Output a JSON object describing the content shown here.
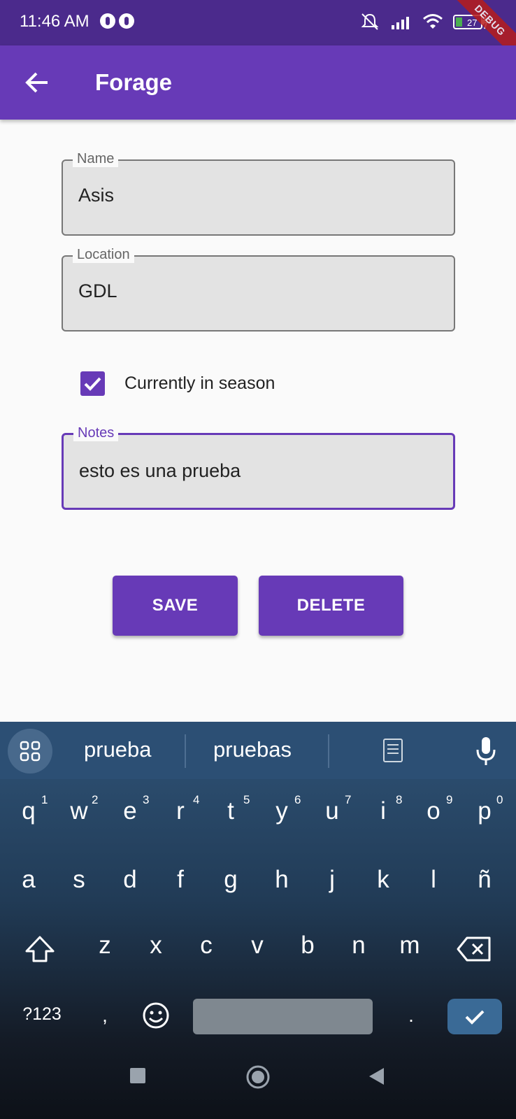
{
  "status_bar": {
    "time": "11:46 AM",
    "battery": "27",
    "debug_banner": "DEBUG"
  },
  "app_bar": {
    "title": "Forage"
  },
  "form": {
    "name": {
      "label": "Name",
      "value": "Asis"
    },
    "location": {
      "label": "Location",
      "value": "GDL"
    },
    "in_season": {
      "label": "Currently in season",
      "checked": true
    },
    "notes": {
      "label": "Notes",
      "value": "esto es una prueba"
    }
  },
  "buttons": {
    "save": "SAVE",
    "delete": "DELETE"
  },
  "keyboard": {
    "suggestions": [
      "prueba",
      "pruebas"
    ],
    "row1": [
      "q",
      "w",
      "e",
      "r",
      "t",
      "y",
      "u",
      "i",
      "o",
      "p"
    ],
    "row1_hints": [
      "1",
      "2",
      "3",
      "4",
      "5",
      "6",
      "7",
      "8",
      "9",
      "0"
    ],
    "row2": [
      "a",
      "s",
      "d",
      "f",
      "g",
      "h",
      "j",
      "k",
      "l",
      "ñ"
    ],
    "row3": [
      "z",
      "x",
      "c",
      "v",
      "b",
      "n",
      "m"
    ],
    "symbols_key": "?123",
    "comma_key": ",",
    "period_key": "."
  },
  "colors": {
    "primary": "#673ab7",
    "status_bar": "#4b2a8c"
  }
}
